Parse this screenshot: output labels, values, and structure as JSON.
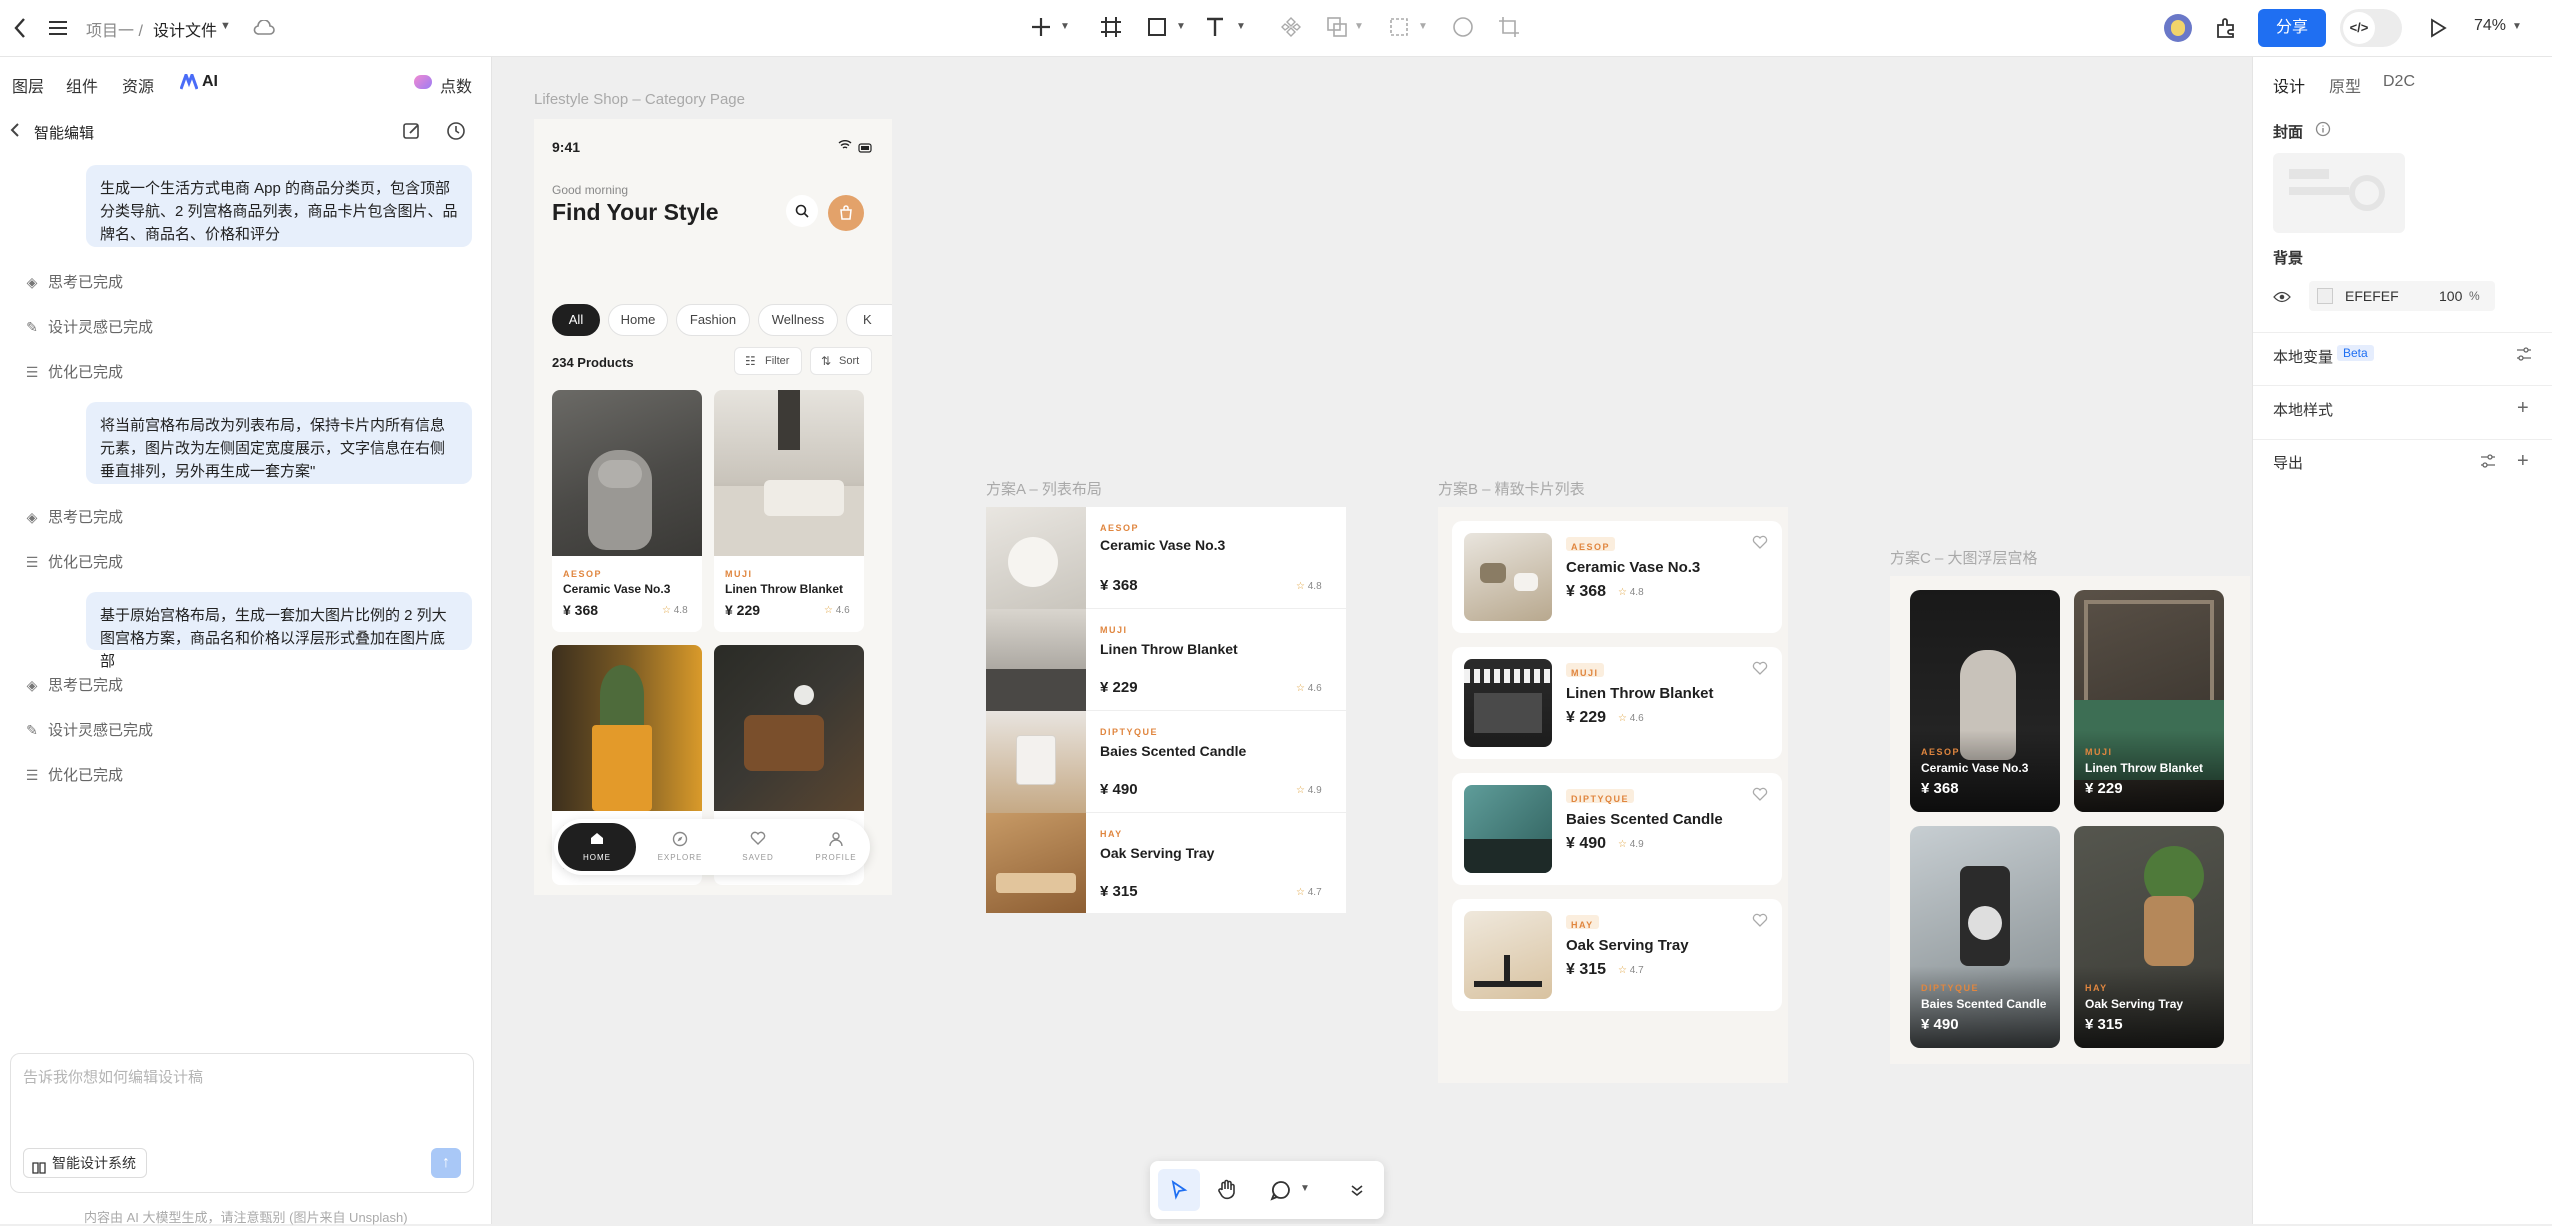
{
  "topbar": {
    "project": "项目一 /",
    "file": "设计文件",
    "share": "分享",
    "zoom": "74%"
  },
  "left": {
    "tabs": [
      "图层",
      "组件",
      "资源",
      "AI",
      "点数"
    ],
    "header": "智能编辑",
    "messages": [
      "生成一个生活方式电商 App 的商品分类页，包含顶部分类导航、2 列宫格商品列表，商品卡片包含图片、品牌名、商品名、价格和评分",
      "将当前宫格布局改为列表布局，保持卡片内所有信息元素，图片改为左侧固定宽度展示，文字信息在右侧垂直排列，另外再生成一套方案\"",
      "基于原始宫格布局，生成一套加大图片比例的 2 列大图宫格方案，商品名和价格以浮层形式叠加在图片底部"
    ],
    "steps": [
      "思考已完成",
      "设计灵感已完成",
      "优化已完成",
      "思考已完成",
      "优化已完成",
      "思考已完成",
      "设计灵感已完成",
      "优化已完成"
    ],
    "input_placeholder": "告诉我你想如何编辑设计稿",
    "design_system": "智能设计系统",
    "footer": "内容由 AI 大模型生成，请注意甄别 (图片来自 Unsplash)"
  },
  "right": {
    "tabs": [
      "设计",
      "原型",
      "D2C"
    ],
    "cover": "封面",
    "background": "背景",
    "bg_hex": "EFEFEF",
    "bg_opacity": "100",
    "bg_pct": "%",
    "local_vars": "本地变量",
    "beta": "Beta",
    "local_styles": "本地样式",
    "export": "导出"
  },
  "frames": {
    "main_label": "Lifestyle Shop – Category Page",
    "a_label": "方案A – 列表布局",
    "b_label": "方案B – 精致卡片列表",
    "c_label": "方案C – 大图浮层宫格"
  },
  "phone": {
    "time": "9:41",
    "greeting": "Good morning",
    "title": "Find Your Style",
    "chips": [
      "All",
      "Home",
      "Fashion",
      "Wellness",
      "K"
    ],
    "count": "234 Products",
    "filter": "Filter",
    "sort": "Sort",
    "nav": [
      "HOME",
      "EXPLORE",
      "SAVED",
      "PROFILE"
    ]
  },
  "products": [
    {
      "brand": "AESOP",
      "name": "Ceramic Vase No.3",
      "price": "¥ 368",
      "rating": "4.8"
    },
    {
      "brand": "MUJI",
      "name": "Linen Throw Blanket",
      "price": "¥ 229",
      "rating": "4.6"
    },
    {
      "brand": "DIPTYQUE",
      "name": "Baies Scented Candle",
      "price": "¥ 490",
      "rating": "4.9"
    },
    {
      "brand": "HAY",
      "name": "Oak Serving Tray",
      "price": "¥ 315",
      "rating": "4.7"
    }
  ],
  "colors": {
    "accent": "#1f6ff2",
    "brand_tag": "#e0863f",
    "bubble": "#e7effb",
    "canvas": "#efefef",
    "dark": "#1f1f1f"
  },
  "icons": [
    "back-arrow-icon",
    "menu-icon",
    "cloud-icon",
    "plus-icon",
    "frame-icon",
    "rect-icon",
    "text-icon",
    "component-icon",
    "boolean-icon",
    "mask-icon",
    "circle-icon",
    "crop-icon",
    "plugin-icon",
    "code-icon",
    "play-icon",
    "pointer-icon",
    "hand-icon",
    "comment-icon",
    "eye-icon",
    "heart-icon",
    "star-icon"
  ]
}
